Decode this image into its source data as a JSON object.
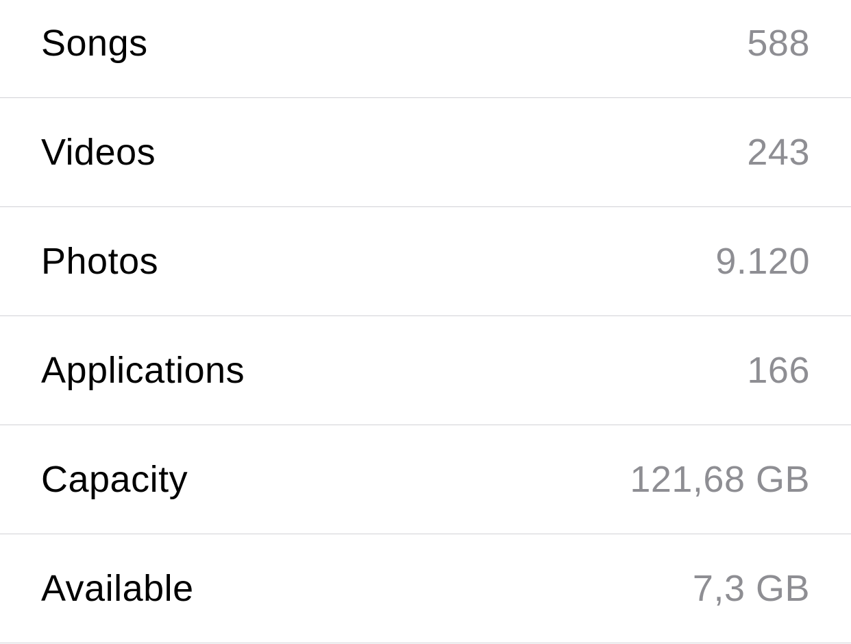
{
  "rows": [
    {
      "label": "Songs",
      "value": "588"
    },
    {
      "label": "Videos",
      "value": "243"
    },
    {
      "label": "Photos",
      "value": "9.120"
    },
    {
      "label": "Applications",
      "value": "166"
    },
    {
      "label": "Capacity",
      "value": "121,68 GB"
    },
    {
      "label": "Available",
      "value": "7,3 GB"
    }
  ]
}
